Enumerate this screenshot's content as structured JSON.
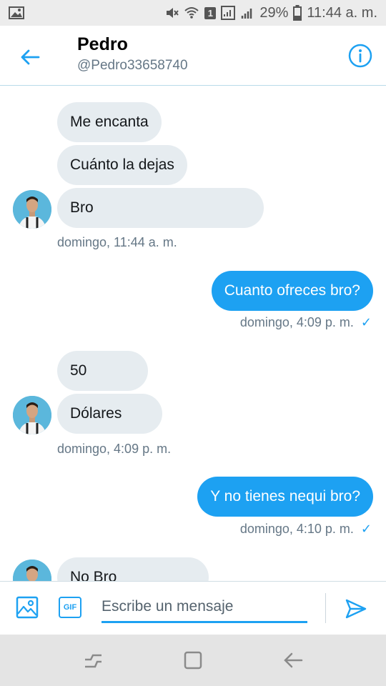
{
  "status_bar": {
    "battery": "29%",
    "sim_badge": "1",
    "time": "11:44 a. m."
  },
  "header": {
    "name": "Pedro",
    "handle": "@Pedro33658740"
  },
  "messages": [
    {
      "dir": "in",
      "text": "Me encanta"
    },
    {
      "dir": "in",
      "text": "Cuánto la dejas"
    },
    {
      "dir": "in",
      "text": "Bro"
    },
    {
      "dir": "out",
      "text": "Cuanto ofreces bro?"
    },
    {
      "dir": "in",
      "text": "50"
    },
    {
      "dir": "in",
      "text": "Dólares"
    },
    {
      "dir": "out",
      "text": "Y no tienes nequi bro?"
    },
    {
      "dir": "in",
      "text": "No Bro"
    }
  ],
  "timestamps": [
    {
      "text": "domingo, 11:44 a. m."
    },
    {
      "text": "domingo, 4:09 p. m.",
      "read_mark": "✓"
    },
    {
      "text": "domingo, 4:09 p. m."
    },
    {
      "text": "domingo, 4:10 p. m.",
      "read_mark": "✓"
    }
  ],
  "composer": {
    "gif_label": "GIF",
    "placeholder": "Escribe un mensaje"
  },
  "colors": {
    "accent": "#1da1f2",
    "incoming_bubble": "#e6ecf0",
    "secondary_text": "#657786"
  },
  "icons": {
    "back": "arrow-left-icon",
    "info": "info-icon",
    "media": "image-icon",
    "send": "send-icon",
    "nav_recents": "recents-icon",
    "nav_home": "home-icon",
    "nav_back": "back-icon"
  }
}
